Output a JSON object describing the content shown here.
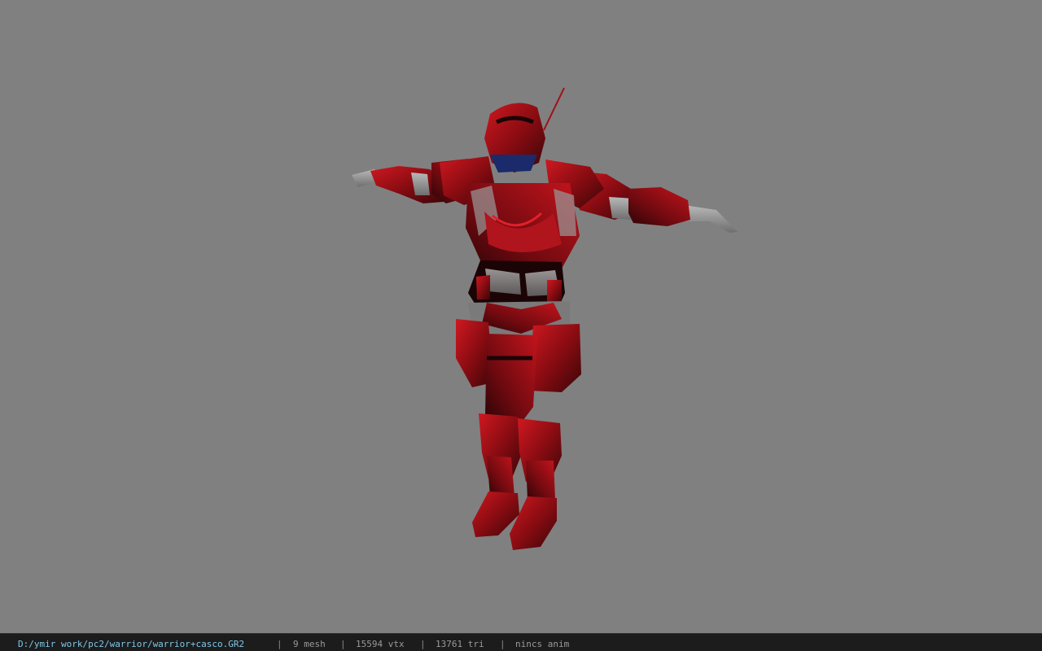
{
  "viewport": {
    "background_color": "#808080",
    "model_palette": {
      "armor_red": "#b01018",
      "armor_dark": "#2a0608",
      "skin_gray": "#9c9c9c",
      "visor_blue": "#1a2a6a"
    }
  },
  "statusbar": {
    "file_path": "D:/ymir work/pc2/warrior/warrior+casco.GR2",
    "mesh_count": "9 mesh",
    "vertex_count": "15594 vtx",
    "triangle_count": "13761 tri",
    "animation": "nincs anim",
    "separator": "|",
    "path_color": "#7ec8e8"
  }
}
